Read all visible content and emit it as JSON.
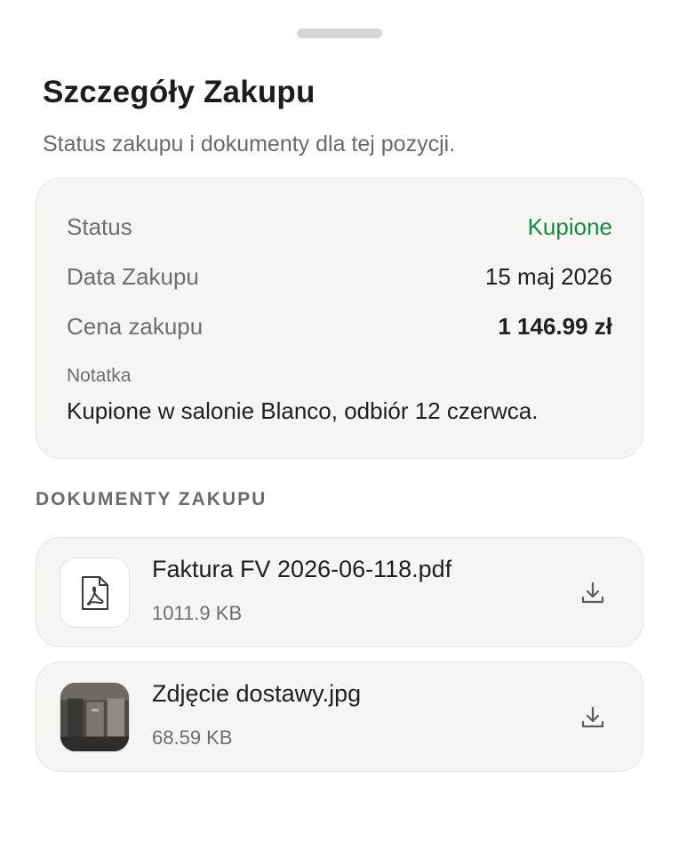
{
  "sheet": {
    "title": "Szczegóły Zakupu",
    "subtitle": "Status zakupu i dokumenty dla tej pozycji."
  },
  "details": {
    "status_label": "Status",
    "status_value": "Kupione",
    "status_color": "#178a43",
    "date_label": "Data Zakupu",
    "date_value": "15 maj 2026",
    "price_label": "Cena zakupu",
    "price_value": "1 146.99 zł",
    "note_label": "Notatka",
    "note_value": "Kupione w salonie Blanco, odbiór 12 czerwca."
  },
  "documents": {
    "section_title": "DOKUMENTY ZAKUPU",
    "items": [
      {
        "name": "Faktura FV 2026-06-118.pdf",
        "size": "1011.9 KB",
        "icon": "pdf-file-icon"
      },
      {
        "name": "Zdjęcie dostawy.jpg",
        "size": "68.59 KB",
        "icon": "photo-thumbnail"
      }
    ]
  }
}
